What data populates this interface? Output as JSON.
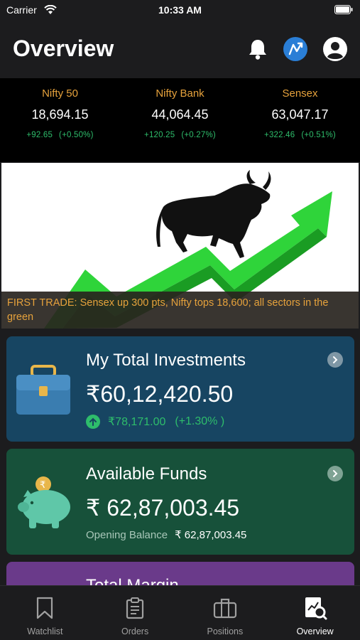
{
  "status_bar": {
    "carrier": "Carrier",
    "time": "10:33 AM"
  },
  "header": {
    "title": "Overview"
  },
  "indices": [
    {
      "name": "Nifty 50",
      "value": "18,694.15",
      "change": "+92.65",
      "percent": "(+0.50%)"
    },
    {
      "name": "Nifty Bank",
      "value": "44,064.45",
      "change": "+120.25",
      "percent": "(+0.27%)"
    },
    {
      "name": "Sensex",
      "value": "63,047.17",
      "change": "+322.46",
      "percent": "(+0.51%)"
    }
  ],
  "banner": {
    "caption": "FIRST TRADE: Sensex up 300 pts, Nifty tops 18,600; all sectors in the green"
  },
  "investments": {
    "title": "My Total Investments",
    "amount": "₹60,12,420.50",
    "change": "₹78,171.00",
    "percent": "(+1.30% )"
  },
  "funds": {
    "title": "Available Funds",
    "amount": "₹ 62,87,003.45",
    "opening_label": "Opening Balance",
    "opening_value": "₹ 62,87,003.45"
  },
  "margin": {
    "title": "Total Margin"
  },
  "tabs": [
    {
      "label": "Watchlist",
      "icon": "bookmark-icon"
    },
    {
      "label": "Orders",
      "icon": "clipboard-icon"
    },
    {
      "label": "Positions",
      "icon": "briefcase-icon"
    },
    {
      "label": "Overview",
      "icon": "overview-chart-icon"
    }
  ],
  "colors": {
    "gain": "#2ebd6b",
    "accent_gold": "#e6a23c",
    "invest_card": "#174562",
    "funds_card": "#17513a",
    "margin_card": "#6a3a8a"
  }
}
